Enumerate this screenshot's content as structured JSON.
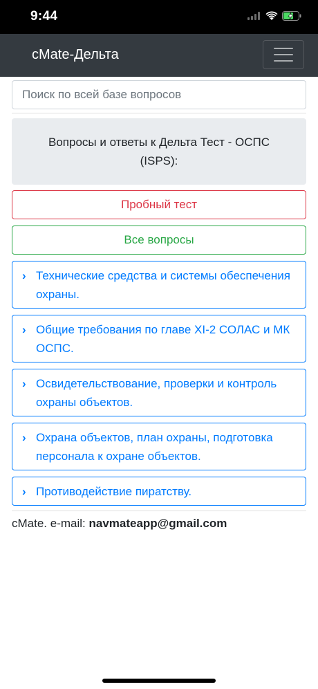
{
  "status_bar": {
    "time": "9:44",
    "icons": [
      "signal-icon",
      "wifi-icon",
      "battery-charging-icon"
    ],
    "battery_color": "#4cd964"
  },
  "navbar": {
    "brand": "cMate-Дельта",
    "menu_icon": "hamburger-icon"
  },
  "search": {
    "placeholder": "Поиск по всей базе вопросов",
    "value": ""
  },
  "header": {
    "text": "Вопросы и ответы к Дельта Тест - ОСПС (ISPS):"
  },
  "buttons": {
    "practice_test": "Пробный тест",
    "all_questions": "Все вопросы"
  },
  "categories": [
    {
      "label": "Технические средства и системы обеспечения охраны.",
      "icon": "chevron-right-icon"
    },
    {
      "label": "Общие требования по главе XI-2 СОЛАС и МК ОСПС.",
      "icon": "chevron-right-icon"
    },
    {
      "label": "Освидетельствование, проверки и контроль охраны объектов.",
      "icon": "chevron-right-icon"
    },
    {
      "label": "Охрана объектов, план охраны, подготовка персонала к охране объектов.",
      "icon": "chevron-right-icon"
    },
    {
      "label": "Противодействие пиратству.",
      "icon": "chevron-right-icon"
    }
  ],
  "footer": {
    "prefix": "cMate. e-mail: ",
    "email": "navmateapp@gmail.com"
  },
  "colors": {
    "navbar": "#343a40",
    "danger": "#dc3545",
    "success": "#28a745",
    "primary": "#007bff"
  }
}
